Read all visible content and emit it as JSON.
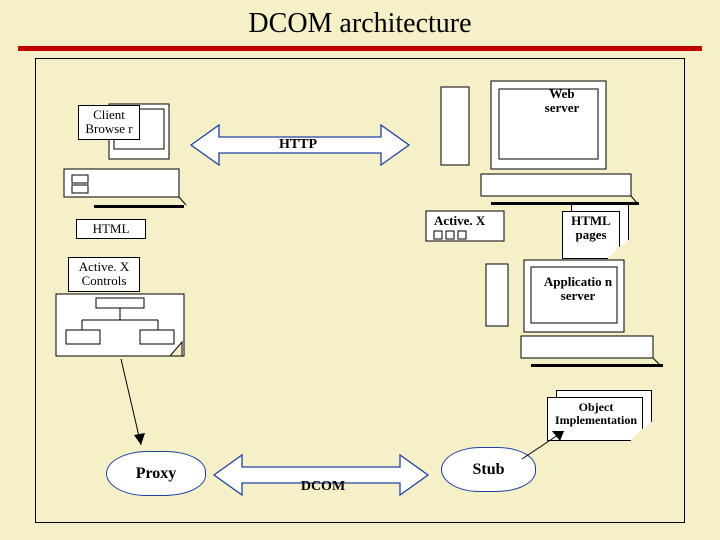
{
  "title": "DCOM architecture",
  "client_browser": "Client Browse r",
  "http": "HTTP",
  "web_server": "Web server",
  "html": "HTML",
  "activex": "Active. X",
  "html_pages": "HTML pages",
  "activex_controls": "Active. X Controls",
  "app_server": "Applicatio n server",
  "object_impl": "Object Implementation",
  "proxy": "Proxy",
  "dcom": "DCOM",
  "stub": "Stub"
}
